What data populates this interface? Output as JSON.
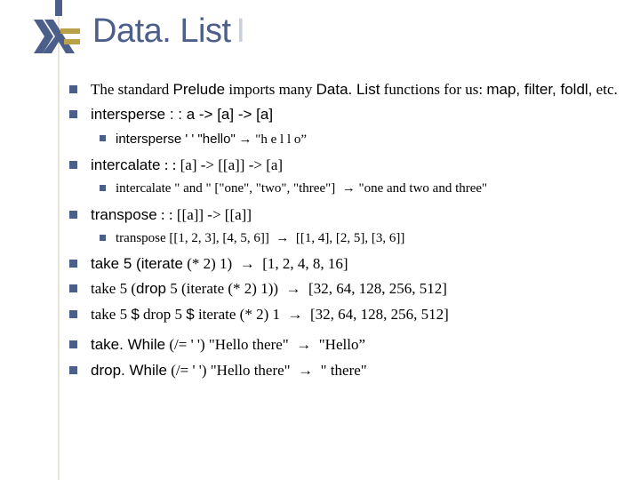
{
  "title_main": "Data. List",
  "title_suffix": "I",
  "lines": {
    "b1": "The standard <span class='sans'>Prelude</span> imports many <span class='sans'>Data. List</span> functions for us: <span class='sans'>map, filter, foldl,</span> etc.",
    "b2": "<span class='sans'>intersperse : : a -> [a] -> [a]</span>",
    "b2s1": "<span class='sans'>intersperse ' ' \"hello\"</span> <span class='arrow'>&rarr;</span> \"h&nbsp;e&nbsp;l&nbsp;l&nbsp;o”",
    "b3": "<span class='sans'>intercalate</span> : : [a] -> [[a]] -> [a]",
    "b3s1": "intercalate \" and \" [\"one\", \"two\", \"three\"]&nbsp;&nbsp;<span class='arrow'>&rarr;</span>&nbsp;\"one and two and three\"",
    "b4": "<span class='sans'>transpose</span> : : [[a]] -> [[a]]",
    "b4s1": "transpose [[1, 2, 3], [4, 5, 6]]&nbsp;&nbsp;<span class='arrow'>&rarr;</span>&nbsp;&nbsp;[[1, 4], [2, 5], [3, 6]]",
    "b5": "<span class='sans'>take 5 (iterate</span> (* 2) 1)&nbsp;&nbsp;<span class='arrow'>&rarr;</span>&nbsp;&nbsp;[1, 2, 4, 8, 16]",
    "b6": "take 5 (<span class='sans'>drop</span> 5 (iterate (* 2) 1))&nbsp;&nbsp;<span class='arrow'>&rarr;</span>&nbsp;&nbsp;[32, 64, 128, 256, 512]",
    "b7": "take 5 <span class='sans'>$</span> drop 5 <span class='sans'>$</span> iterate (* 2) 1&nbsp;&nbsp;<span class='arrow'>&rarr;</span>&nbsp;&nbsp;[32, 64, 128, 256, 512]",
    "b8": "<span class='sans'>take. While</span> (/= ' ') \"Hello there\"&nbsp;&nbsp;<span class='arrow'>&rarr;</span>&nbsp;&nbsp;\"Hello”",
    "b9": "<span class='sans'>drop. While</span> (/= ' ') \"Hello there\"&nbsp;&nbsp;<span class='arrow'>&rarr;</span>&nbsp;&nbsp;\" there\""
  }
}
